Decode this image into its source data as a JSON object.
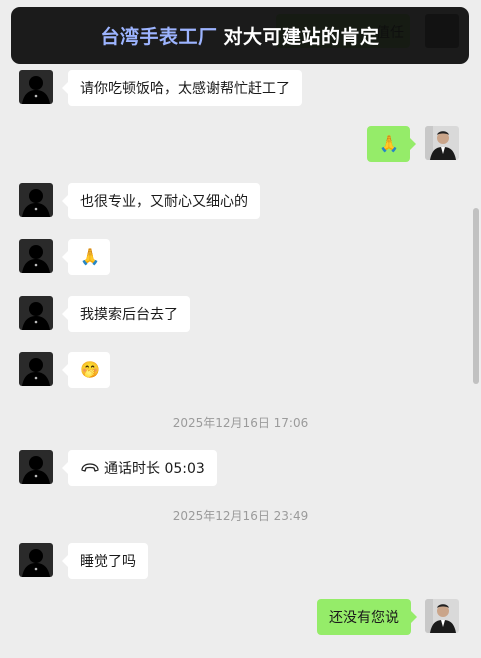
{
  "banner": {
    "brand": "台湾手表工厂",
    "rest": "对大可建站的肯定"
  },
  "partial_top": {
    "text": "值任"
  },
  "messages": [
    {
      "side": "in",
      "text": "请你吃顿饭哈，太感谢帮忙赶工了"
    },
    {
      "side": "out",
      "text": "🙏"
    },
    {
      "side": "in",
      "text": "也很专业，又耐心又细心的"
    },
    {
      "side": "in",
      "text": "🙏"
    },
    {
      "side": "in",
      "text": "我摸索后台去了"
    },
    {
      "side": "in",
      "text": "🤭"
    },
    {
      "side": "in",
      "call_label": "通话时长 05:03"
    },
    {
      "side": "in",
      "text": "睡觉了吗"
    },
    {
      "side": "out",
      "text": "还没有您说"
    }
  ],
  "timestamps": [
    "2025年12月16日 17:06",
    "2025年12月16日 23:49"
  ],
  "icons": {
    "call": "phone-hangup-icon"
  },
  "colors": {
    "background": "#ededed",
    "incoming_bubble": "#ffffff",
    "outgoing_bubble": "#95ec69",
    "banner_bg": "#0e0e0e",
    "banner_brand": "#9db4ff",
    "timestamp_text": "#9b9b9b"
  }
}
